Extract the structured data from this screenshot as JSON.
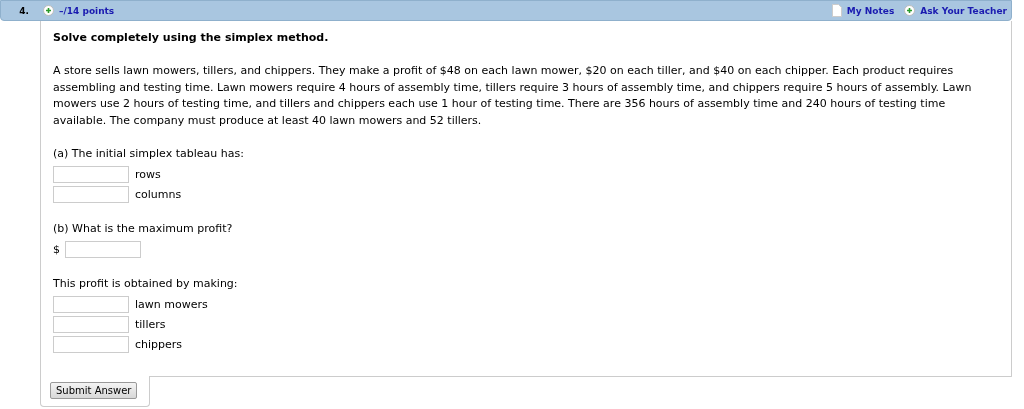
{
  "question": {
    "number": "4.",
    "points": "–/14 points",
    "links": [
      {
        "label": "My Notes",
        "kind": "notes"
      },
      {
        "label": "Ask Your Teacher",
        "kind": "ask"
      }
    ]
  },
  "instruction": "Solve completely using the simplex method.",
  "problem": "A store sells lawn mowers, tillers, and chippers. They make a profit of $48 on each lawn mower, $20 on each tiller, and $40 on each chipper. Each product requires assembling and testing time. Lawn mowers require 4 hours of assembly time, tillers require 3 hours of assembly time, and chippers require 5 hours of assembly. Lawn mowers use 2 hours of testing time, and tillers and chippers each use 1 hour of testing time. There are 356 hours of assembly time and 240 hours of testing time available. The company must produce at least 40 lawn mowers and 52 tillers.",
  "parts": [
    {
      "prompt": "(a) The initial simplex tableau has:",
      "blanks": [
        {
          "unit": "rows"
        },
        {
          "unit": "columns"
        }
      ]
    },
    {
      "prompt": "(b) What is the maximum profit?",
      "blanks": [
        {
          "prefix": "$"
        }
      ]
    },
    {
      "prompt": "This profit is obtained by making:",
      "blanks": [
        {
          "unit": "lawn mowers"
        },
        {
          "unit": "tillers"
        },
        {
          "unit": "chippers"
        }
      ]
    }
  ],
  "submit": "Submit Answer"
}
